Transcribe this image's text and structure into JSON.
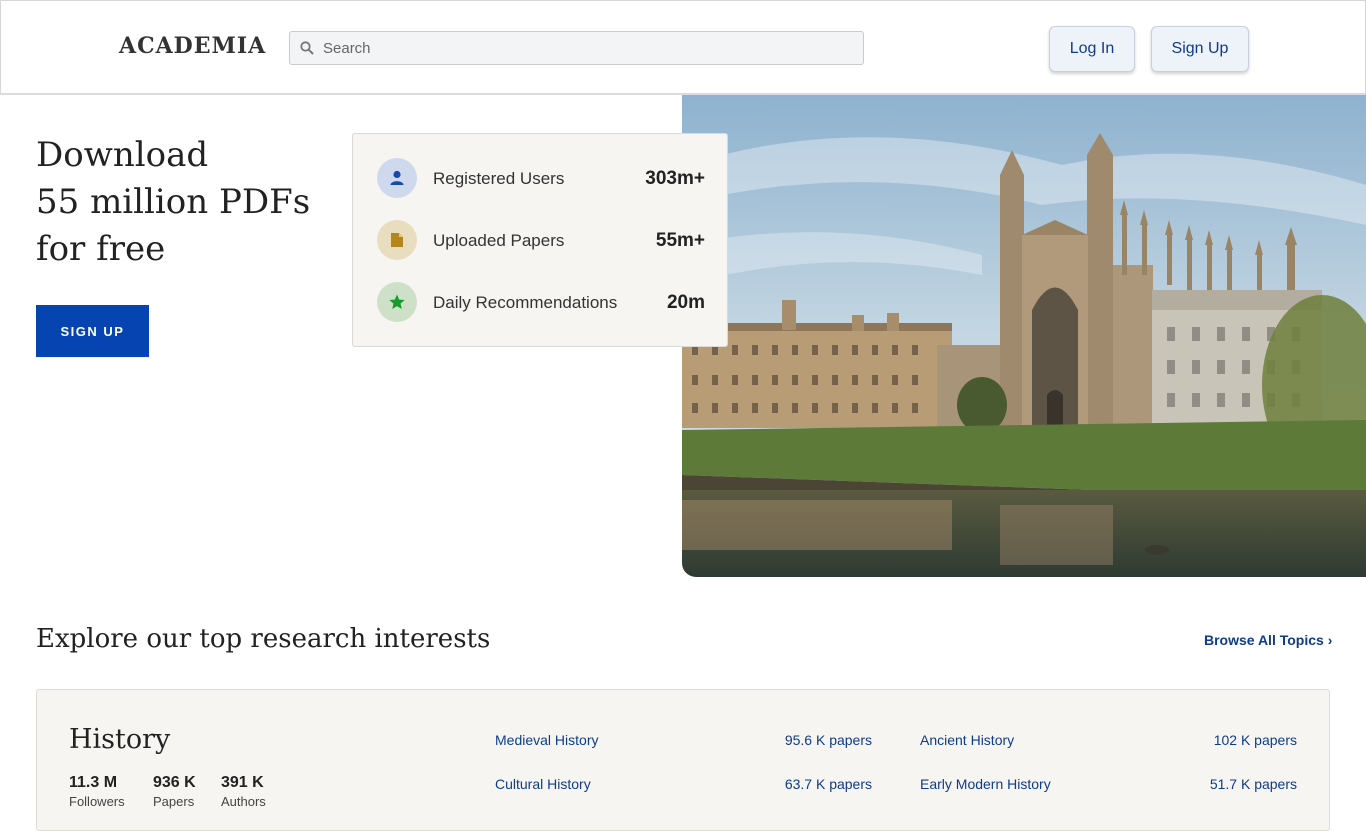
{
  "header": {
    "logo": "ACADEMIA",
    "search_placeholder": "Search",
    "login": "Log In",
    "signup": "Sign Up"
  },
  "hero": {
    "title_lines": [
      "Download",
      "55 million PDFs",
      "for free"
    ],
    "cta": "SIGN UP"
  },
  "stats": [
    {
      "label": "Registered Users",
      "value": "303m+",
      "icon": "user-icon",
      "color": "#cfd9ee"
    },
    {
      "label": "Uploaded Papers",
      "value": "55m+",
      "icon": "document-icon",
      "color": "#e8ddbf"
    },
    {
      "label": "Daily Recommendations",
      "value": "20m",
      "icon": "star-icon",
      "color": "#cfe0c8"
    }
  ],
  "explore": {
    "title": "Explore our top research interests",
    "browse": "Browse All Topics ›"
  },
  "topic": {
    "name": "History",
    "stats": [
      {
        "value": "11.3 M",
        "label": "Followers"
      },
      {
        "value": "936 K",
        "label": "Papers"
      },
      {
        "value": "391 K",
        "label": "Authors"
      }
    ],
    "subtopics": [
      {
        "name": "Medieval History",
        "count": "95.6 K papers"
      },
      {
        "name": "Ancient History",
        "count": "102 K papers"
      },
      {
        "name": "Cultural History",
        "count": "63.7 K papers"
      },
      {
        "name": "Early Modern History",
        "count": "51.7 K papers"
      }
    ]
  },
  "colors": {
    "brand": "#0645b1",
    "link": "#0f3c8a"
  }
}
